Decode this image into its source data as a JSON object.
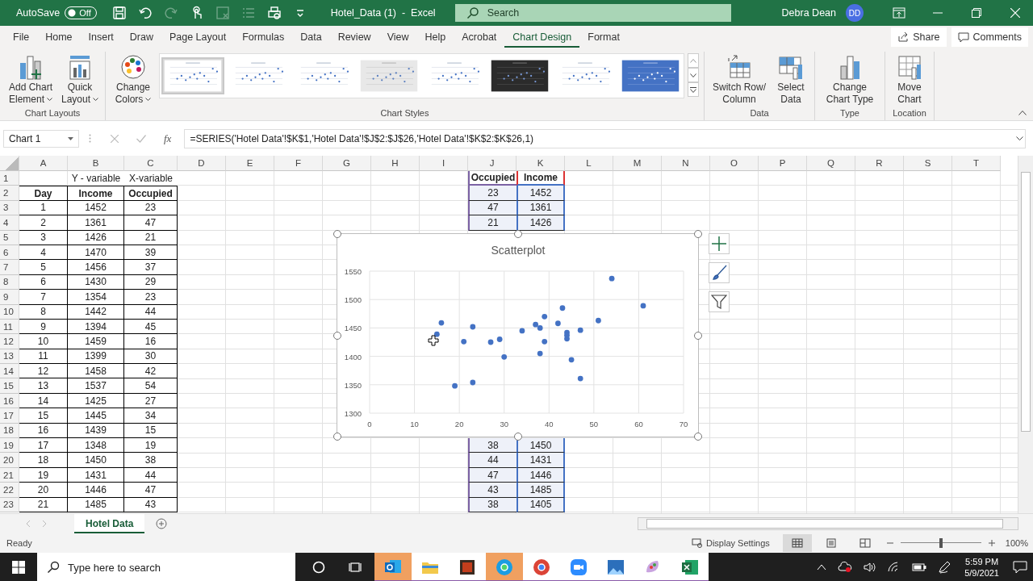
{
  "title_bar": {
    "autosave_label": "AutoSave",
    "autosave": {
      "on": false,
      "label": "Off"
    },
    "quick_access": [
      {
        "kind": "save",
        "disabled": false
      },
      {
        "kind": "undo",
        "disabled": false
      },
      {
        "kind": "redo",
        "disabled": true
      },
      {
        "kind": "touch",
        "disabled": false
      },
      {
        "kind": "form",
        "disabled": true
      },
      {
        "kind": "list",
        "disabled": true
      },
      {
        "kind": "print",
        "disabled": false
      },
      {
        "kind": "customize",
        "disabled": false
      }
    ],
    "title": "Hotel_Data (1)  -  Excel",
    "search": {
      "placeholder": "Search"
    },
    "user": "Debra Dean",
    "avatar": "DD"
  },
  "ribbon_tabs": [
    {
      "label": "File",
      "selected": false
    },
    {
      "label": "Home",
      "selected": false
    },
    {
      "label": "Insert",
      "selected": false
    },
    {
      "label": "Draw",
      "selected": false
    },
    {
      "label": "Page Layout",
      "selected": false
    },
    {
      "label": "Formulas",
      "selected": false
    },
    {
      "label": "Data",
      "selected": false
    },
    {
      "label": "Review",
      "selected": false
    },
    {
      "label": "View",
      "selected": false
    },
    {
      "label": "Help",
      "selected": false
    },
    {
      "label": "Acrobat",
      "selected": false
    },
    {
      "label": "Chart Design",
      "selected": true
    },
    {
      "label": "Format",
      "selected": false
    }
  ],
  "share": "Share",
  "comments": "Comments",
  "ribbon_groups": [
    {
      "label": "Chart Layouts",
      "commands": [
        {
          "kind": "add_chart_element",
          "label": "Add Chart Element",
          "dropdown": true
        },
        {
          "kind": "quick_layout",
          "label": "Quick Layout",
          "dropdown": true
        }
      ]
    },
    {
      "label": "Chart Styles",
      "commands": [
        {
          "kind": "change_colors",
          "label": "Change Colors",
          "dropdown": true
        }
      ],
      "styles": [
        {
          "kind": "light",
          "selected": true
        },
        {
          "kind": "light",
          "selected": false
        },
        {
          "kind": "light",
          "selected": false
        },
        {
          "kind": "grey",
          "selected": false
        },
        {
          "kind": "light",
          "selected": false
        },
        {
          "kind": "dark",
          "selected": false
        },
        {
          "kind": "light",
          "selected": false
        },
        {
          "kind": "blue",
          "selected": false
        }
      ]
    },
    {
      "label": "Data",
      "commands": [
        {
          "kind": "switch_row_column",
          "label": "Switch Row/ Column",
          "dropdown": false
        },
        {
          "kind": "select_data",
          "label": "Select Data",
          "dropdown": false
        }
      ]
    },
    {
      "label": "Type",
      "commands": [
        {
          "kind": "change_chart_type",
          "label": "Change Chart Type",
          "dropdown": false
        }
      ]
    },
    {
      "label": "Location",
      "commands": [
        {
          "kind": "move_chart",
          "label": "Move Chart",
          "dropdown": false
        }
      ]
    }
  ],
  "formula_bar": {
    "name_box": "Chart 1",
    "function_label": "fx",
    "formula": "=SERIES('Hotel Data'!$K$1,'Hotel Data'!$J$2:$J$26,'Hotel Data'!$K$2:$K$26,1)"
  },
  "sheet": {
    "column_headers": [
      "A",
      "B",
      "C",
      "D",
      "E",
      "F",
      "G",
      "H",
      "I",
      "J",
      "K",
      "L",
      "M",
      "N",
      "O",
      "P",
      "Q",
      "R",
      "S",
      "T"
    ],
    "row_headers": [
      "1",
      "2",
      "3",
      "4",
      "5",
      "6",
      "7",
      "8",
      "9",
      "10",
      "11",
      "12",
      "13",
      "14",
      "15",
      "16",
      "17",
      "18",
      "19",
      "20",
      "21",
      "22",
      "23"
    ],
    "variable_labels": [
      "Y - variable",
      "X-variable"
    ],
    "table": [
      [
        "Day",
        "Income",
        "Occupied"
      ],
      [
        "1",
        "1452",
        "23"
      ],
      [
        "2",
        "1361",
        "47"
      ],
      [
        "3",
        "1426",
        "21"
      ],
      [
        "4",
        "1470",
        "39"
      ],
      [
        "5",
        "1456",
        "37"
      ],
      [
        "6",
        "1430",
        "29"
      ],
      [
        "7",
        "1354",
        "23"
      ],
      [
        "8",
        "1442",
        "44"
      ],
      [
        "9",
        "1394",
        "45"
      ],
      [
        "10",
        "1459",
        "16"
      ],
      [
        "11",
        "1399",
        "30"
      ],
      [
        "12",
        "1458",
        "42"
      ],
      [
        "13",
        "1537",
        "54"
      ],
      [
        "14",
        "1425",
        "27"
      ],
      [
        "15",
        "1445",
        "34"
      ],
      [
        "16",
        "1439",
        "15"
      ],
      [
        "17",
        "1348",
        "19"
      ],
      [
        "18",
        "1450",
        "38"
      ],
      [
        "19",
        "1431",
        "44"
      ],
      [
        "20",
        "1446",
        "47"
      ],
      [
        "21",
        "1485",
        "43"
      ]
    ],
    "chart_source": {
      "headers": [
        "Occupied",
        "Income"
      ],
      "top_rows": [
        [
          "23",
          "1452"
        ],
        [
          "47",
          "1361"
        ],
        [
          "21",
          "1426"
        ]
      ],
      "bottom_rows": [
        [
          "38",
          "1450"
        ],
        [
          "44",
          "1431"
        ],
        [
          "47",
          "1446"
        ],
        [
          "43",
          "1485"
        ],
        [
          "38",
          "1405"
        ]
      ]
    },
    "chart": {
      "chart_data": {
        "type": "scatter",
        "title": "Scatterplot",
        "grid": true,
        "x": [
          23,
          47,
          21,
          39,
          37,
          29,
          23,
          44,
          45,
          16,
          30,
          42,
          54,
          27,
          34,
          15,
          19,
          38,
          44,
          47,
          43,
          38,
          39,
          44,
          51,
          61
        ],
        "series": [
          {
            "color": "#4472c4",
            "values": [
              1452,
              1361,
              1426,
              1470,
              1456,
              1430,
              1354,
              1442,
              1394,
              1459,
              1399,
              1458,
              1537,
              1425,
              1445,
              1439,
              1348,
              1450,
              1431,
              1446,
              1485,
              1405,
              1426,
              1437,
              1463,
              1489
            ]
          }
        ],
        "xlim": [
          0,
          70
        ],
        "ylim": [
          1300,
          1550
        ],
        "xticks": [
          0,
          10,
          20,
          30,
          40,
          50,
          60,
          70
        ],
        "yticks": [
          1300,
          1350,
          1400,
          1450,
          1500,
          1550
        ]
      }
    }
  },
  "sheet_tabs": [
    {
      "label": "Hotel Data",
      "selected": true
    }
  ],
  "status_bar": {
    "status": "Ready",
    "display_settings": "Display Settings",
    "views": [
      {
        "kind": "normal",
        "selected": true
      },
      {
        "kind": "page_layout",
        "selected": false
      },
      {
        "kind": "page_break",
        "selected": false
      }
    ],
    "zoom": {
      "level": 0.5,
      "label": "100%"
    }
  },
  "taskbar": {
    "search_placeholder": "Type here to search",
    "apps": [
      {
        "kind": "mail",
        "highlighted": true
      },
      {
        "kind": "folder",
        "highlighted": false
      },
      {
        "kind": "slides",
        "highlighted": false
      },
      {
        "kind": "edge",
        "highlighted": true
      },
      {
        "kind": "chrome",
        "highlighted": false
      },
      {
        "kind": "video",
        "highlighted": false
      },
      {
        "kind": "photos",
        "highlighted": false
      },
      {
        "kind": "paint",
        "highlighted": false
      },
      {
        "kind": "excel",
        "highlighted": false
      }
    ],
    "time": "5:59 PM",
    "date": "5/9/2021"
  }
}
